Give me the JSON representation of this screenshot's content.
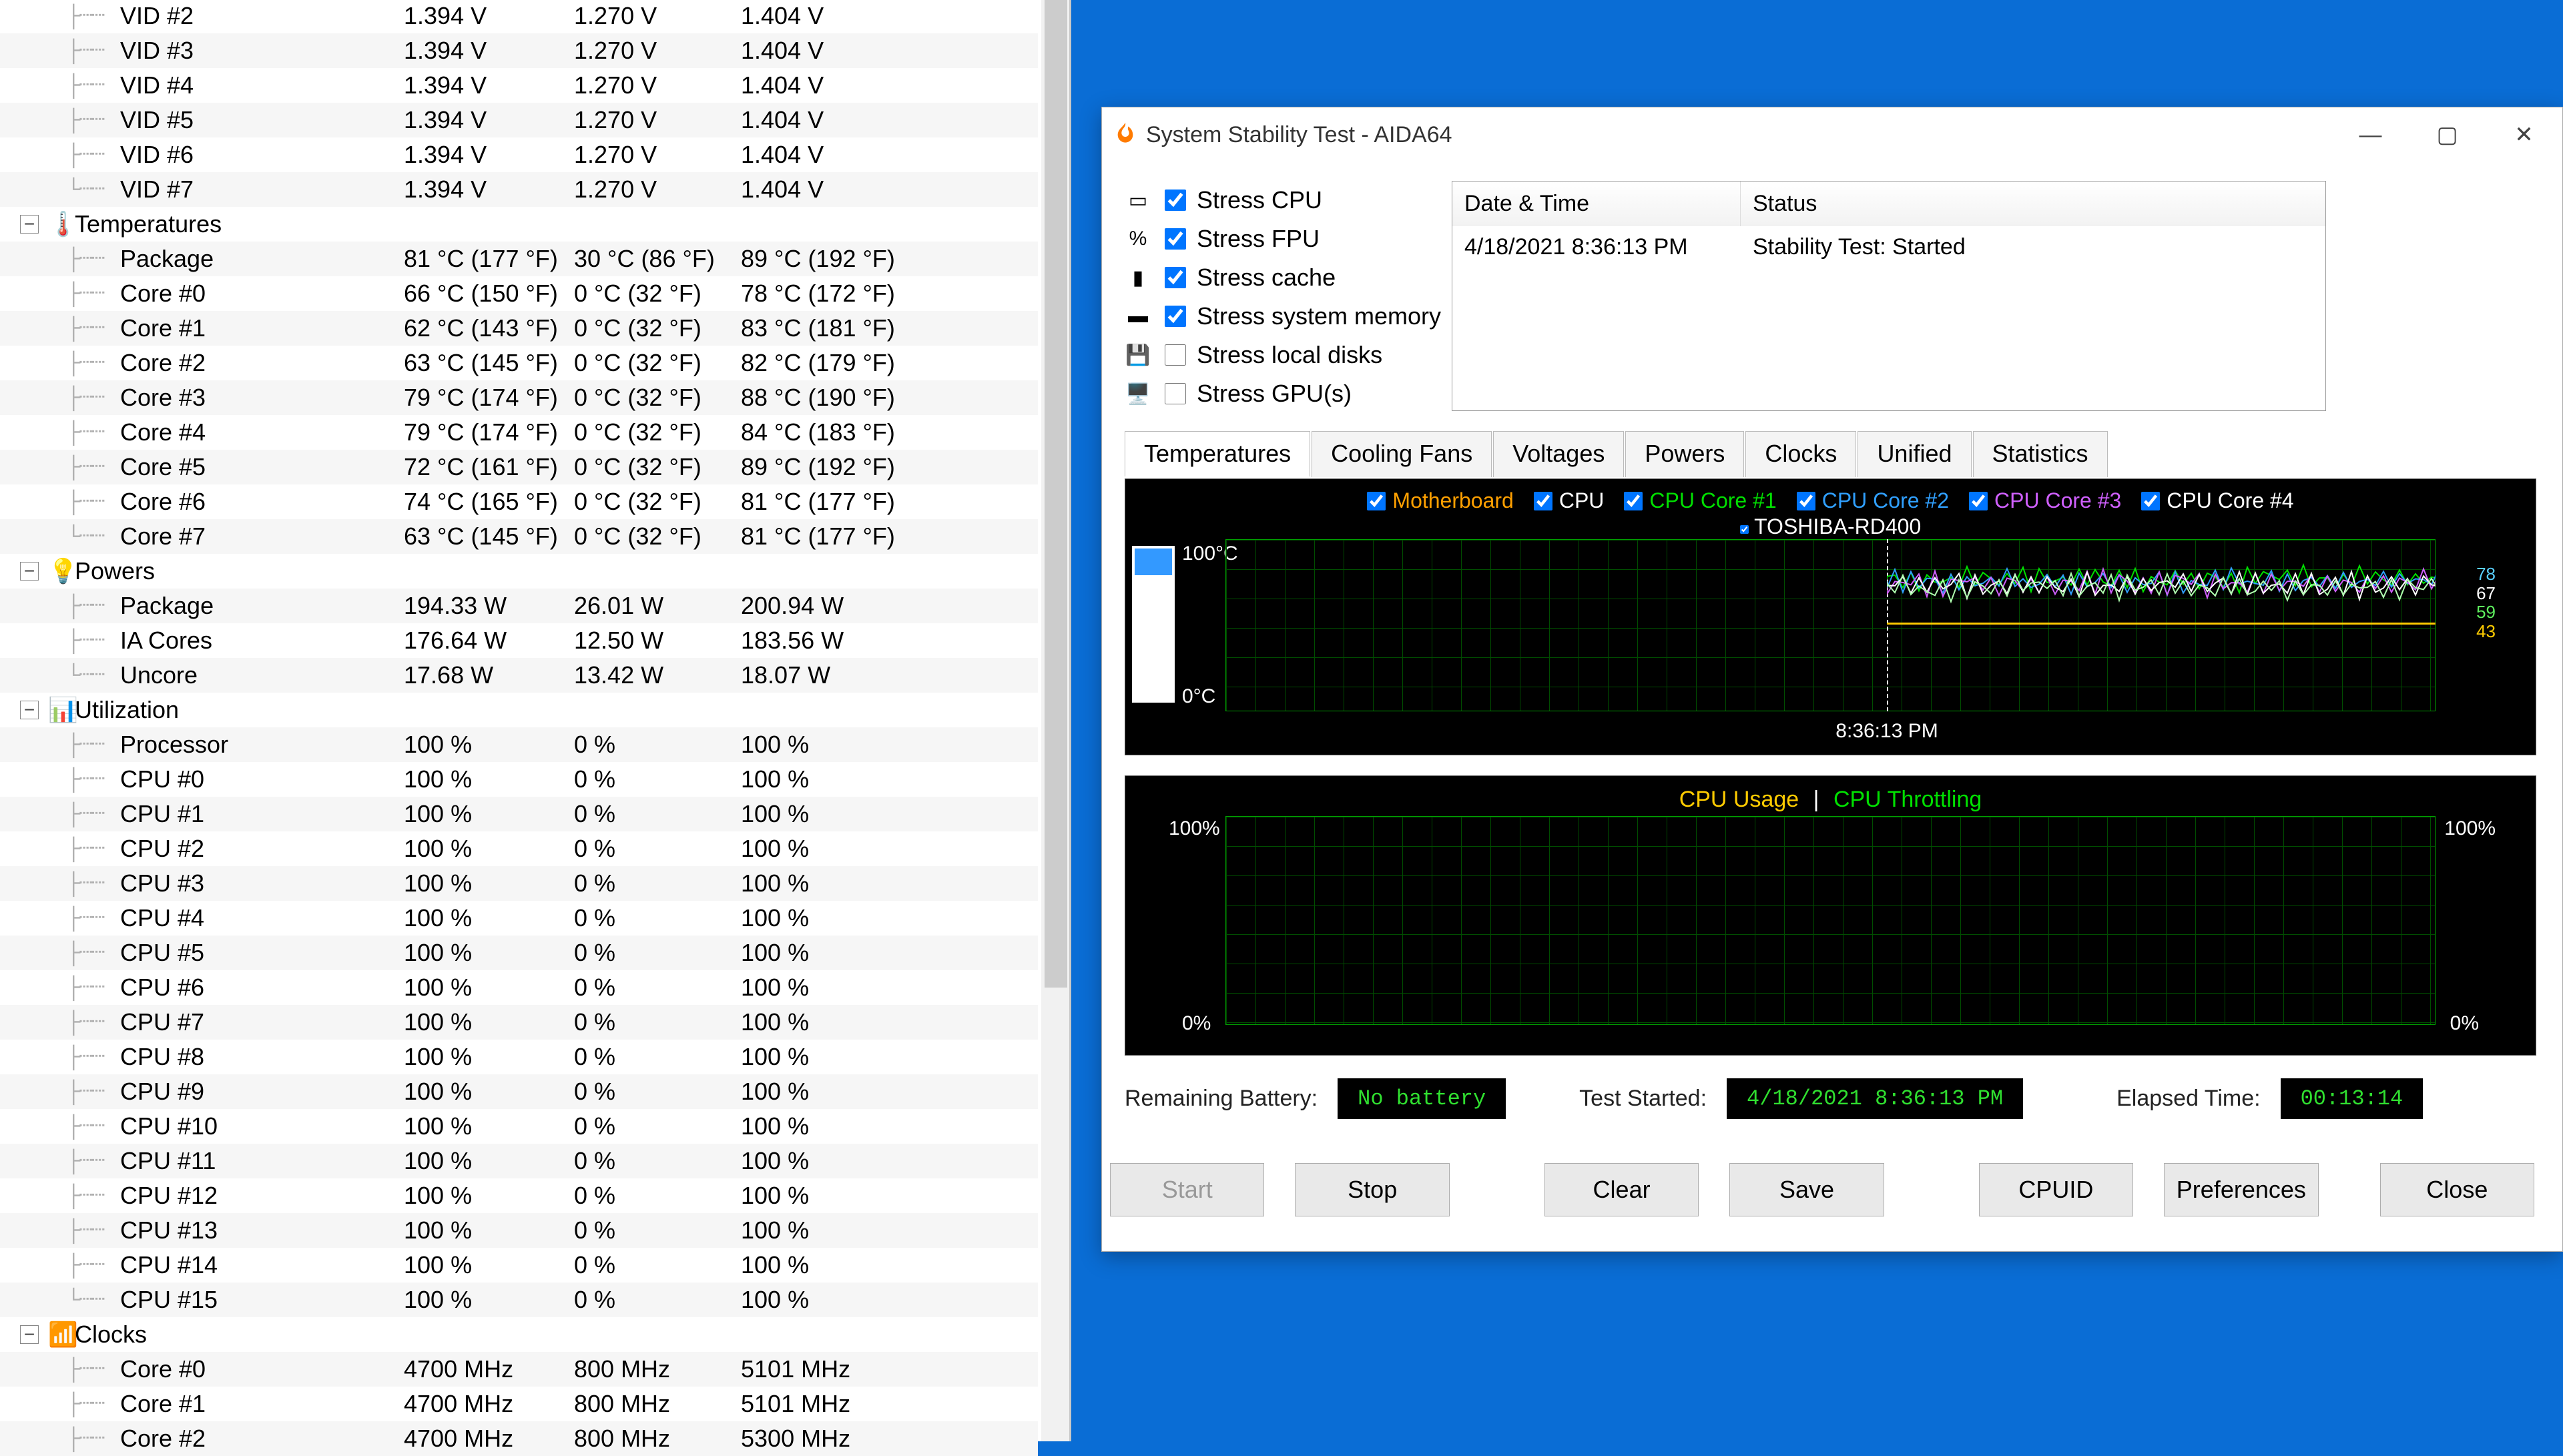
{
  "monitor": {
    "vids": [
      {
        "name": "VID #2",
        "v1": "1.394 V",
        "v2": "1.270 V",
        "v3": "1.404 V"
      },
      {
        "name": "VID #3",
        "v1": "1.394 V",
        "v2": "1.270 V",
        "v3": "1.404 V"
      },
      {
        "name": "VID #4",
        "v1": "1.394 V",
        "v2": "1.270 V",
        "v3": "1.404 V"
      },
      {
        "name": "VID #5",
        "v1": "1.394 V",
        "v2": "1.270 V",
        "v3": "1.404 V"
      },
      {
        "name": "VID #6",
        "v1": "1.394 V",
        "v2": "1.270 V",
        "v3": "1.404 V"
      },
      {
        "name": "VID #7",
        "v1": "1.394 V",
        "v2": "1.270 V",
        "v3": "1.404 V"
      }
    ],
    "groups": {
      "temperatures": {
        "label": "Temperatures",
        "icon": "🌡️"
      },
      "powers": {
        "label": "Powers",
        "icon": "💡"
      },
      "utilization": {
        "label": "Utilization",
        "icon": "📊"
      },
      "clocks": {
        "label": "Clocks",
        "icon": "📶"
      }
    },
    "temperatures": [
      {
        "name": "Package",
        "v1": "81 °C  (177 °F)",
        "v2": "30 °C  (86 °F)",
        "v3": "89 °C  (192 °F)"
      },
      {
        "name": "Core #0",
        "v1": "66 °C  (150 °F)",
        "v2": "0 °C  (32 °F)",
        "v3": "78 °C  (172 °F)"
      },
      {
        "name": "Core #1",
        "v1": "62 °C  (143 °F)",
        "v2": "0 °C  (32 °F)",
        "v3": "83 °C  (181 °F)"
      },
      {
        "name": "Core #2",
        "v1": "63 °C  (145 °F)",
        "v2": "0 °C  (32 °F)",
        "v3": "82 °C  (179 °F)"
      },
      {
        "name": "Core #3",
        "v1": "79 °C  (174 °F)",
        "v2": "0 °C  (32 °F)",
        "v3": "88 °C  (190 °F)"
      },
      {
        "name": "Core #4",
        "v1": "79 °C  (174 °F)",
        "v2": "0 °C  (32 °F)",
        "v3": "84 °C  (183 °F)"
      },
      {
        "name": "Core #5",
        "v1": "72 °C  (161 °F)",
        "v2": "0 °C  (32 °F)",
        "v3": "89 °C  (192 °F)"
      },
      {
        "name": "Core #6",
        "v1": "74 °C  (165 °F)",
        "v2": "0 °C  (32 °F)",
        "v3": "81 °C  (177 °F)"
      },
      {
        "name": "Core #7",
        "v1": "63 °C  (145 °F)",
        "v2": "0 °C  (32 °F)",
        "v3": "81 °C  (177 °F)"
      }
    ],
    "powers": [
      {
        "name": "Package",
        "v1": "194.33 W",
        "v2": "26.01 W",
        "v3": "200.94 W"
      },
      {
        "name": "IA Cores",
        "v1": "176.64 W",
        "v2": "12.50 W",
        "v3": "183.56 W"
      },
      {
        "name": "Uncore",
        "v1": "17.68 W",
        "v2": "13.42 W",
        "v3": "18.07 W"
      }
    ],
    "utilization": [
      {
        "name": "Processor",
        "v1": "100 %",
        "v2": "0 %",
        "v3": "100 %"
      },
      {
        "name": "CPU #0",
        "v1": "100 %",
        "v2": "0 %",
        "v3": "100 %"
      },
      {
        "name": "CPU #1",
        "v1": "100 %",
        "v2": "0 %",
        "v3": "100 %"
      },
      {
        "name": "CPU #2",
        "v1": "100 %",
        "v2": "0 %",
        "v3": "100 %"
      },
      {
        "name": "CPU #3",
        "v1": "100 %",
        "v2": "0 %",
        "v3": "100 %"
      },
      {
        "name": "CPU #4",
        "v1": "100 %",
        "v2": "0 %",
        "v3": "100 %"
      },
      {
        "name": "CPU #5",
        "v1": "100 %",
        "v2": "0 %",
        "v3": "100 %"
      },
      {
        "name": "CPU #6",
        "v1": "100 %",
        "v2": "0 %",
        "v3": "100 %"
      },
      {
        "name": "CPU #7",
        "v1": "100 %",
        "v2": "0 %",
        "v3": "100 %"
      },
      {
        "name": "CPU #8",
        "v1": "100 %",
        "v2": "0 %",
        "v3": "100 %"
      },
      {
        "name": "CPU #9",
        "v1": "100 %",
        "v2": "0 %",
        "v3": "100 %"
      },
      {
        "name": "CPU #10",
        "v1": "100 %",
        "v2": "0 %",
        "v3": "100 %"
      },
      {
        "name": "CPU #11",
        "v1": "100 %",
        "v2": "0 %",
        "v3": "100 %"
      },
      {
        "name": "CPU #12",
        "v1": "100 %",
        "v2": "0 %",
        "v3": "100 %"
      },
      {
        "name": "CPU #13",
        "v1": "100 %",
        "v2": "0 %",
        "v3": "100 %"
      },
      {
        "name": "CPU #14",
        "v1": "100 %",
        "v2": "0 %",
        "v3": "100 %"
      },
      {
        "name": "CPU #15",
        "v1": "100 %",
        "v2": "0 %",
        "v3": "100 %"
      }
    ],
    "clocks": [
      {
        "name": "Core #0",
        "v1": "4700 MHz",
        "v2": "800 MHz",
        "v3": "5101 MHz"
      },
      {
        "name": "Core #1",
        "v1": "4700 MHz",
        "v2": "800 MHz",
        "v3": "5101 MHz"
      },
      {
        "name": "Core #2",
        "v1": "4700 MHz",
        "v2": "800 MHz",
        "v3": "5300 MHz"
      }
    ]
  },
  "window": {
    "title": "System Stability Test - AIDA64",
    "stress_options": [
      {
        "label": "Stress CPU",
        "checked": true,
        "icon": "▭"
      },
      {
        "label": "Stress FPU",
        "checked": true,
        "icon": "%"
      },
      {
        "label": "Stress cache",
        "checked": true,
        "icon": "▮"
      },
      {
        "label": "Stress system memory",
        "checked": true,
        "icon": "▬"
      },
      {
        "label": "Stress local disks",
        "checked": false,
        "icon": "💾"
      },
      {
        "label": "Stress GPU(s)",
        "checked": false,
        "icon": "🖥️"
      }
    ],
    "log": {
      "head_date": "Date & Time",
      "head_status": "Status",
      "row_date": "4/18/2021 8:36:13 PM",
      "row_status": "Stability Test: Started"
    },
    "tabs": [
      "Temperatures",
      "Cooling Fans",
      "Voltages",
      "Powers",
      "Clocks",
      "Unified",
      "Statistics"
    ],
    "temp_graph": {
      "top_axis": "100°C",
      "bottom_axis": "0°C",
      "time": "8:36:13 PM",
      "legend": [
        {
          "label": "Motherboard",
          "color": "#ffa000"
        },
        {
          "label": "CPU",
          "color": "#ffffff"
        },
        {
          "label": "CPU Core #1",
          "color": "#00e000"
        },
        {
          "label": "CPU Core #2",
          "color": "#30a0ff"
        },
        {
          "label": "CPU Core #3",
          "color": "#d060ff"
        },
        {
          "label": "CPU Core #4",
          "color": "#ffffff"
        }
      ],
      "legend2": {
        "label": "TOSHIBA-RD400",
        "color": "#ffffff"
      },
      "right_nums": [
        "78",
        "67",
        "59",
        "43"
      ]
    },
    "usage_graph": {
      "label_usage": "CPU Usage",
      "sep": "|",
      "label_throttle": "CPU Throttling",
      "tl": "100%",
      "bl": "0%",
      "tr": "100%",
      "br": "0%"
    },
    "status": {
      "battery_label": "Remaining Battery:",
      "battery_val": "No battery",
      "started_label": "Test Started:",
      "started_val": "4/18/2021 8:36:13 PM",
      "elapsed_label": "Elapsed Time:",
      "elapsed_val": "00:13:14"
    },
    "buttons": {
      "start": "Start",
      "stop": "Stop",
      "clear": "Clear",
      "save": "Save",
      "cpuid": "CPUID",
      "prefs": "Preferences",
      "close": "Close"
    }
  },
  "chart_data": [
    {
      "type": "line",
      "title": "Temperatures",
      "ylabel": "°C",
      "ylim": [
        0,
        100
      ],
      "x_event": "8:36:13 PM",
      "series": [
        {
          "name": "Motherboard",
          "current": 43
        },
        {
          "name": "CPU",
          "current": 67
        },
        {
          "name": "CPU Core #1",
          "current": 78
        },
        {
          "name": "CPU Core #2",
          "current": 78
        },
        {
          "name": "CPU Core #3",
          "current": 78
        },
        {
          "name": "CPU Core #4",
          "current": 78
        },
        {
          "name": "TOSHIBA-RD400",
          "current": 59
        }
      ],
      "annotations_right": [
        78,
        67,
        59,
        43
      ]
    },
    {
      "type": "line",
      "title": "CPU Usage / CPU Throttling",
      "ylabel": "%",
      "ylim": [
        0,
        100
      ],
      "series": [
        {
          "name": "CPU Usage",
          "current": 100
        },
        {
          "name": "CPU Throttling",
          "current": 0
        }
      ]
    }
  ]
}
